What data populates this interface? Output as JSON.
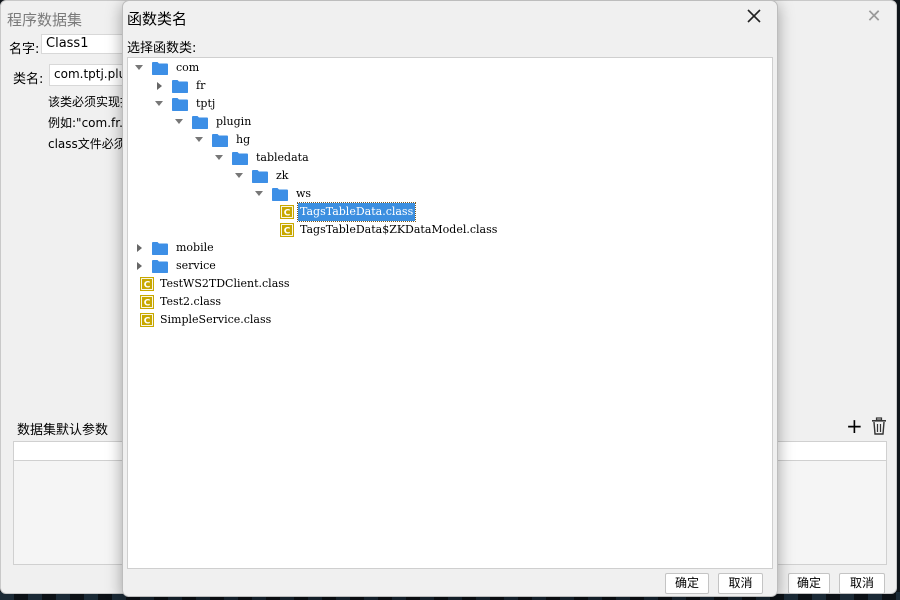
{
  "parent": {
    "title": "程序数据集",
    "name_label": "名字:",
    "name_value": "Class1",
    "class_label": "类名:",
    "class_value": "com.tptj.plug",
    "hint_lines": [
      "该类必须实现抽",
      "例如:\"com.fr.",
      "class文件必须"
    ],
    "params_label": "数据集默认参数",
    "ok_label": "确定",
    "cancel_label": "取消"
  },
  "modal": {
    "title": "函数类名",
    "select_label": "选择函数类:",
    "ok_label": "确定",
    "cancel_label": "取消",
    "tree": [
      {
        "label": "com",
        "type": "folder",
        "state": "expanded",
        "depth": 0
      },
      {
        "label": "fr",
        "type": "folder",
        "state": "collapsed",
        "depth": 1
      },
      {
        "label": "tptj",
        "type": "folder",
        "state": "expanded",
        "depth": 1
      },
      {
        "label": "plugin",
        "type": "folder",
        "state": "expanded",
        "depth": 2
      },
      {
        "label": "hg",
        "type": "folder",
        "state": "expanded",
        "depth": 3
      },
      {
        "label": "tabledata",
        "type": "folder",
        "state": "expanded",
        "depth": 4
      },
      {
        "label": "zk",
        "type": "folder",
        "state": "expanded",
        "depth": 5
      },
      {
        "label": "ws",
        "type": "folder",
        "state": "expanded",
        "depth": 6
      },
      {
        "label": "TagsTableData.class",
        "type": "class",
        "selected": true,
        "depth": 7
      },
      {
        "label": "TagsTableData$ZKDataModel.class",
        "type": "class",
        "depth": 7
      },
      {
        "label": "mobile",
        "type": "folder",
        "state": "collapsed",
        "depth": 0
      },
      {
        "label": "service",
        "type": "folder",
        "state": "collapsed",
        "depth": 0
      },
      {
        "label": "TestWS2TDClient.class",
        "type": "class",
        "depth": 0
      },
      {
        "label": "Test2.class",
        "type": "class",
        "depth": 0
      },
      {
        "label": "SimpleService.class",
        "type": "class",
        "depth": 0
      }
    ]
  },
  "colors": {
    "folder": "#3d8fe6",
    "class_icon": "#c8a800",
    "selection": "#3c8fe0"
  },
  "icons": {
    "folder": "folder-icon",
    "class": "class-file-icon",
    "expand": "chevron-down-icon",
    "collapse": "chevron-right-icon",
    "add": "plus-icon",
    "delete": "trash-icon",
    "close": "close-icon"
  }
}
